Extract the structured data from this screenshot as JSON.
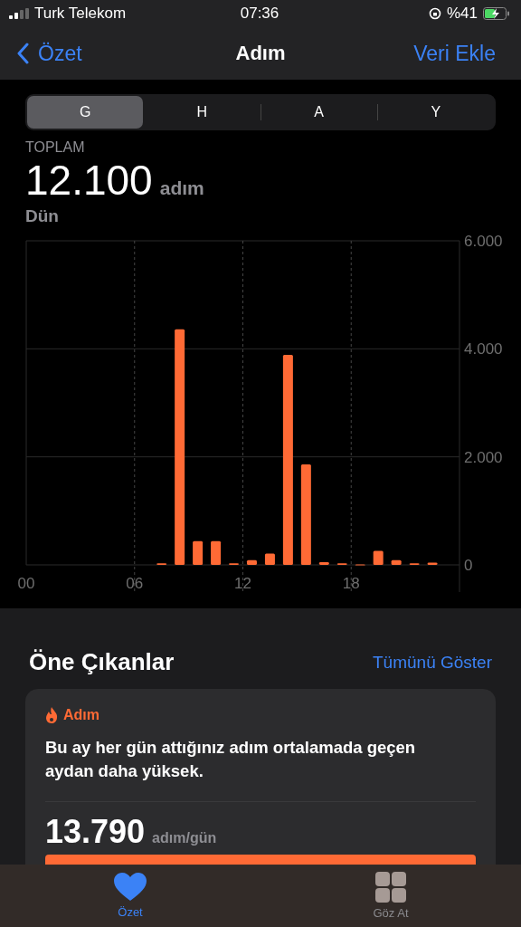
{
  "status_bar": {
    "carrier": "Turk Telekom",
    "time": "07:36",
    "battery": "%41"
  },
  "nav": {
    "back": "Özet",
    "title": "Adım",
    "action": "Veri Ekle"
  },
  "segments": [
    {
      "label": "G",
      "selected": true
    },
    {
      "label": "H",
      "selected": false
    },
    {
      "label": "A",
      "selected": false
    },
    {
      "label": "Y",
      "selected": false
    }
  ],
  "summary": {
    "label": "TOPLAM",
    "value": "12.100",
    "unit": "adım",
    "period": "Dün"
  },
  "chart_data": {
    "type": "bar",
    "x": [
      7.5,
      8.5,
      9.5,
      10.5,
      11.5,
      12.5,
      13.5,
      14.5,
      15.5,
      16.5,
      17.5,
      18.5,
      19.5,
      20.5,
      21.5,
      22.5
    ],
    "series": [
      {
        "color": "#ff6a35",
        "values": [
          30,
          4360,
          440,
          440,
          30,
          90,
          210,
          3890,
          1860,
          50,
          30,
          10,
          260,
          90,
          30,
          40
        ]
      }
    ],
    "xlim": [
      0,
      24
    ],
    "ylim": [
      0,
      6000
    ],
    "grid": true,
    "yticks": [
      {
        "value": 0,
        "label": "0"
      },
      {
        "value": 2000,
        "label": "2.000"
      },
      {
        "value": 4000,
        "label": "4.000"
      },
      {
        "value": 6000,
        "label": "6.000"
      }
    ],
    "xticks": [
      {
        "value": 0,
        "label": "00"
      },
      {
        "value": 6,
        "label": "06"
      },
      {
        "value": 12,
        "label": "12"
      },
      {
        "value": 18,
        "label": "18"
      }
    ]
  },
  "highlights": {
    "title": "Öne Çıkanlar",
    "show_all": "Tümünü Göster",
    "card": {
      "category": "Adım",
      "text": "Bu ay her gün attığınız adım ortalamada geçen aydan daha yüksek.",
      "value": "13.790",
      "unit": "adım/gün"
    }
  },
  "tab_bar": [
    {
      "label": "Özet",
      "selected": true
    },
    {
      "label": "Göz At",
      "selected": false
    }
  ]
}
